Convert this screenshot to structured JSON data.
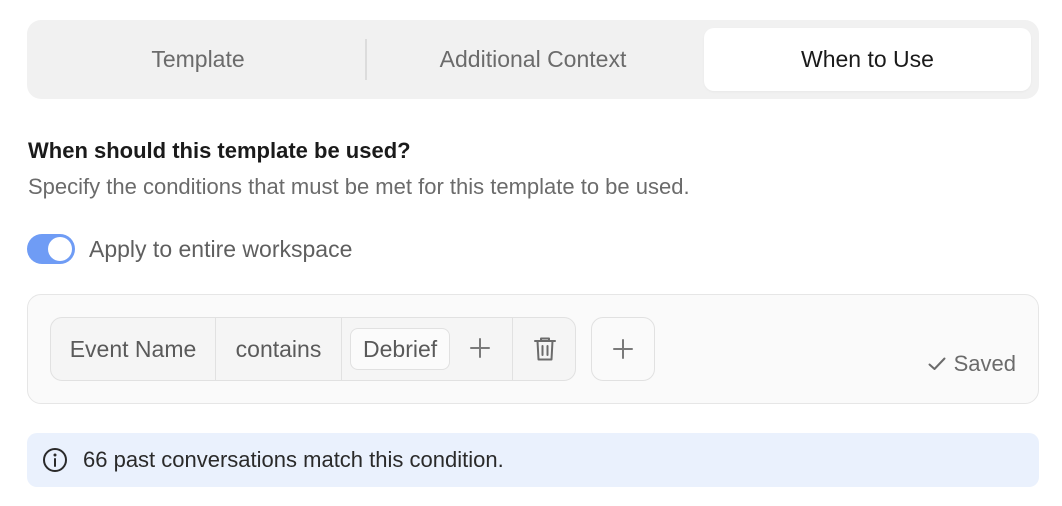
{
  "tabs": [
    {
      "label": "Template",
      "active": false
    },
    {
      "label": "Additional Context",
      "active": false
    },
    {
      "label": "When to Use",
      "active": true
    }
  ],
  "section": {
    "title": "When should this template be used?",
    "description": "Specify the conditions that must be met for this template to be used."
  },
  "toggle": {
    "label": "Apply to entire workspace",
    "on": true,
    "color": "#6f9cf5"
  },
  "condition": {
    "field": "Event Name",
    "operator": "contains",
    "values": [
      "Debrief"
    ],
    "add_value_icon": "plus-icon",
    "delete_icon": "trash-icon",
    "add_condition_icon": "plus-icon"
  },
  "status": {
    "icon": "check-icon",
    "text": "Saved"
  },
  "info": {
    "icon": "info-circle-icon",
    "text": "66 past conversations match this condition.",
    "background": "#eaf1fd"
  }
}
